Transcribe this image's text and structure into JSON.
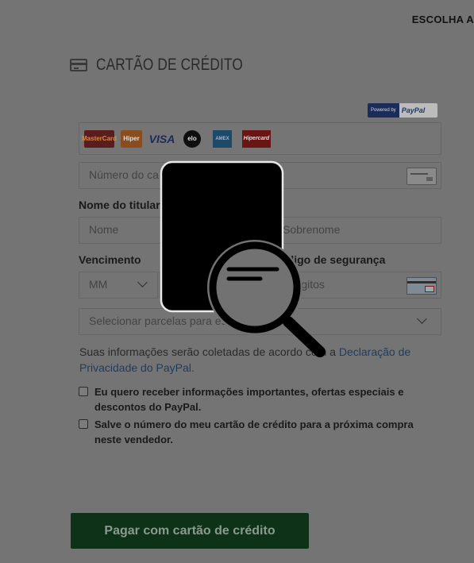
{
  "header": {
    "top_right_text": "ESCOLHA A"
  },
  "section": {
    "title": "CARTÃO DE CRÉDITO",
    "icon": "credit-card-icon"
  },
  "paypal_badge": {
    "powered_by": "Powered by",
    "brand": "PayPal"
  },
  "card_brands": [
    {
      "name": "Mastercard",
      "label": "MasterCard",
      "icon": "mastercard-logo"
    },
    {
      "name": "Hiper",
      "label": "Hiper",
      "icon": "hiper-logo"
    },
    {
      "name": "Visa",
      "label": "VISA",
      "icon": "visa-logo"
    },
    {
      "name": "Elo",
      "label": "elo",
      "icon": "elo-logo"
    },
    {
      "name": "American Express",
      "label": "AMEX",
      "icon": "amex-logo"
    },
    {
      "name": "Hipercard",
      "label": "Hipercard",
      "icon": "hipercard-logo"
    }
  ],
  "form": {
    "card_number_placeholder": "Número do ca",
    "holder_label": "Nome do titular",
    "first_name_placeholder": "Nome",
    "last_name_placeholder": "Sobrenome",
    "expiry_label": "Vencimento",
    "month_placeholder": "MM",
    "security_label": "Código de segurança",
    "cvv_placeholder": "3 dígitos",
    "installments_placeholder": "Selecionar parcelas para esta compra"
  },
  "info": {
    "text": "Suas informações serão coletadas de acordo com a",
    "link": "Declaração de Privacidade do PayPal."
  },
  "checkboxes": [
    {
      "label": "Eu quero receber informações importantes, ofertas especiais e descontos do PayPal.",
      "checked": false
    },
    {
      "label": "Salve o número do meu cartão de crédito para a próxima compra neste vendedor.",
      "checked": false
    }
  ],
  "pay_button": {
    "label": "Pagar com cartão de crédito"
  },
  "overlay": {
    "icon": "document-search-icon"
  },
  "colors": {
    "overlay_dim": "#747474",
    "button_bg": "#0e3218",
    "link": "#1e3c5e",
    "paypal_navy": "#1b2b5a"
  }
}
